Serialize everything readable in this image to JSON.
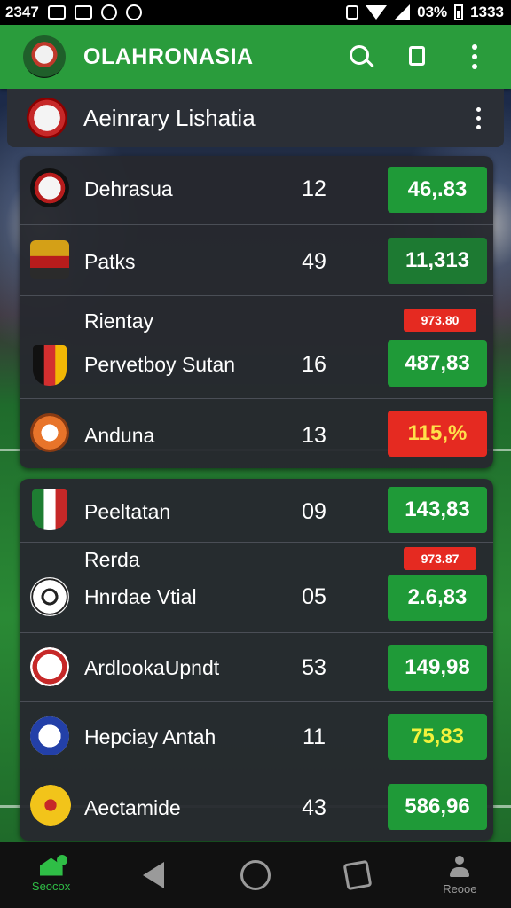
{
  "status_bar": {
    "time_left": "2347",
    "battery": "03%",
    "time_right": "1333"
  },
  "app_bar": {
    "title": "OLAHRONASIA",
    "icons": [
      "search-icon",
      "document-icon",
      "more-vert-icon"
    ]
  },
  "section": {
    "title": "Aeinrary Lishatia",
    "icon": "league-badge-icon"
  },
  "colors": {
    "app_bar": "#2a9c3c",
    "value_green": "#1f9a38",
    "value_red": "#e52a21",
    "card_bg": "#26292f"
  },
  "groups": [
    {
      "rows": [
        {
          "name": "Dehrasua",
          "num": "12",
          "value": "46,.83",
          "style": "green",
          "icon": "team-crest-icon"
        },
        {
          "name": "Patks",
          "num": "49",
          "value": "11,313",
          "style": "dark",
          "icon": "eagle-crest-icon"
        },
        {
          "sub": "Rientay",
          "tag": "973.80",
          "name": "Pervetboy Sutan",
          "num": "16",
          "value": "487,83",
          "style": "green",
          "icon": "shield-crest-icon"
        },
        {
          "name": "Anduna",
          "num": "13",
          "value": "115,%",
          "style": "red",
          "icon": "swoosh-crest-icon"
        }
      ]
    },
    {
      "rows": [
        {
          "name": "Peeltatan",
          "num": "09",
          "value": "143,83",
          "style": "green",
          "icon": "flag-crest-icon"
        },
        {
          "sub": "Rerda",
          "tag": "973.87",
          "name": "Hnrdae Vtial",
          "num": "05",
          "value": "2.6,83",
          "style": "green",
          "icon": "soccer-ball-icon"
        },
        {
          "name": "ArdlookaUpndt",
          "num": "53",
          "value": "149,98",
          "style": "green",
          "icon": "arrow-crest-icon"
        },
        {
          "name": "Hepciay Antah",
          "num": "11",
          "value": "75,83",
          "style": "yellow",
          "icon": "wing-crest-icon"
        },
        {
          "name": "Aectamide",
          "num": "43",
          "value": "586,96",
          "style": "green",
          "icon": "gold-crest-icon"
        }
      ]
    }
  ],
  "nav": {
    "home_label": "Seocox",
    "profile_label": "Reooe"
  }
}
